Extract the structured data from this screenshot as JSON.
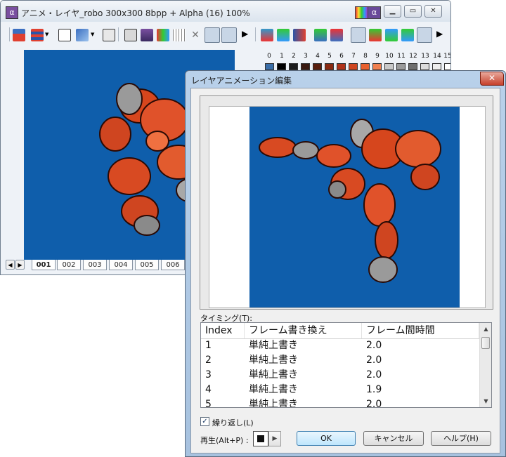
{
  "main_window": {
    "title": "アニメ・レイヤ_robo  300x300  8bpp + Alpha (16)  100%",
    "alpha_badge": "α",
    "icons": [
      "app-icon",
      "palette-icon",
      "alpha-icon",
      "minimize-icon",
      "maximize-icon",
      "close-icon"
    ],
    "tabs": [
      "001",
      "002",
      "003",
      "004",
      "005",
      "006"
    ],
    "palette_indices": [
      "0",
      "1",
      "2",
      "3",
      "4",
      "5",
      "6",
      "7",
      "8",
      "9",
      "10",
      "11",
      "12",
      "13",
      "14",
      "15"
    ],
    "palette_colors": [
      "#3a6ea8",
      "#000000",
      "#1c1c1c",
      "#3a1a10",
      "#5a1f0e",
      "#8a2a12",
      "#b0331a",
      "#cf4520",
      "#e8602e",
      "#f08050",
      "#c8c8c8",
      "#9a9a9a",
      "#6e6e6e",
      "#dcdcdc",
      "#ededed",
      "#ffffff"
    ],
    "canvas_bg": "#0f5eab"
  },
  "dialog": {
    "title": "レイヤアニメーション編集",
    "close_glyph": "✕",
    "timing_label": "タイミング(T):",
    "columns": [
      "Index",
      "フレーム書き換え",
      "フレーム間時間"
    ],
    "rows": [
      {
        "index": "1",
        "mode": "単純上書き",
        "time": "2.0"
      },
      {
        "index": "2",
        "mode": "単純上書き",
        "time": "2.0"
      },
      {
        "index": "3",
        "mode": "単純上書き",
        "time": "2.0"
      },
      {
        "index": "4",
        "mode": "単純上書き",
        "time": "1.9"
      },
      {
        "index": "5",
        "mode": "単純上書き",
        "time": "2.0"
      }
    ],
    "loop_label": "繰り返し(L)",
    "loop_checked": "✓",
    "play_label": "再生(Alt+P) :",
    "ok": "OK",
    "cancel": "キャンセル",
    "help": "ヘルプ(H)",
    "canvas_bg": "#0f5eab"
  }
}
